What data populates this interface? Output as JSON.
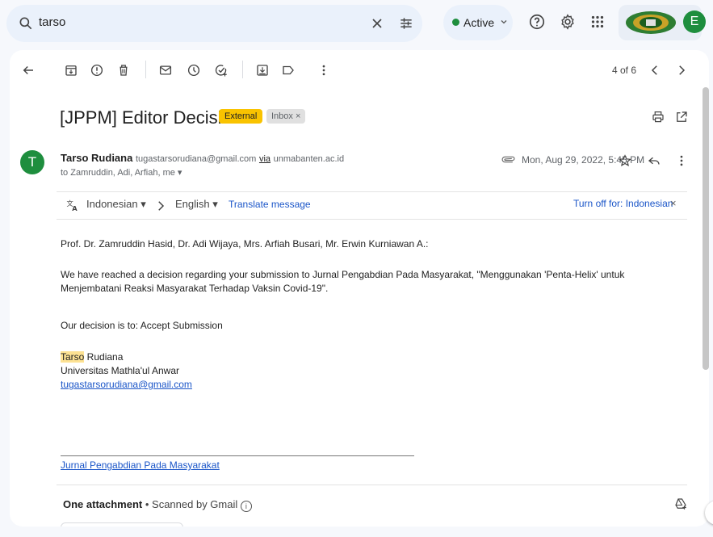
{
  "search": {
    "query": "tarso"
  },
  "status": {
    "label": "Active"
  },
  "account": {
    "avatar_letter": "E"
  },
  "toolbar": {
    "count": "4 of 6"
  },
  "email": {
    "subject": "[JPPM] Editor Decision",
    "labels": {
      "external": "External",
      "inbox": "Inbox",
      "inbox_close": "×"
    },
    "sender_initial": "T",
    "sender_name": "Tarso Rudiana",
    "sender_email": "tugastarsorudiana@gmail.com",
    "via": "via",
    "via_domain": "unmabanten.ac.id",
    "recipients": "to Zamruddin, Adi, Arfiah, me",
    "date": "Mon, Aug 29, 2022, 5:45 PM"
  },
  "translate": {
    "from_lang": "Indonesian",
    "to_lang": "English",
    "translate_link": "Translate message",
    "turn_off": "Turn off for: Indonesian",
    "close": "×"
  },
  "body": {
    "greeting": "Prof. Dr. Zamruddin Hasid, Dr. Adi Wijaya, Mrs. Arfiah Busari, Mr. Erwin Kurniawan A.:",
    "para1": "We have reached a decision regarding your submission to Jurnal Pengabdian Pada Masyarakat, \"Menggunakan 'Penta-Helix' untuk Menjembatani Reaksi Masyarakat Terhadap Vaksin Covid-19\".",
    "para2": "Our decision is to: Accept Submission",
    "sig_first": "Tarso",
    "sig_last": " Rudiana",
    "sig_univ": "Universitas Mathla'ul Anwar",
    "sig_email": "tugastarsorudiana@gmail.com",
    "journal_link": "Jurnal Pengabdian Pada Masyarakat"
  },
  "attachment": {
    "title": "One attachment",
    "sep": " • ",
    "scanned": "Scanned by Gmail"
  },
  "colors": {
    "accent_green": "#1e8e3e",
    "external_badge": "#f9c300",
    "link": "#1a55c8",
    "highlight": "#fde293"
  }
}
